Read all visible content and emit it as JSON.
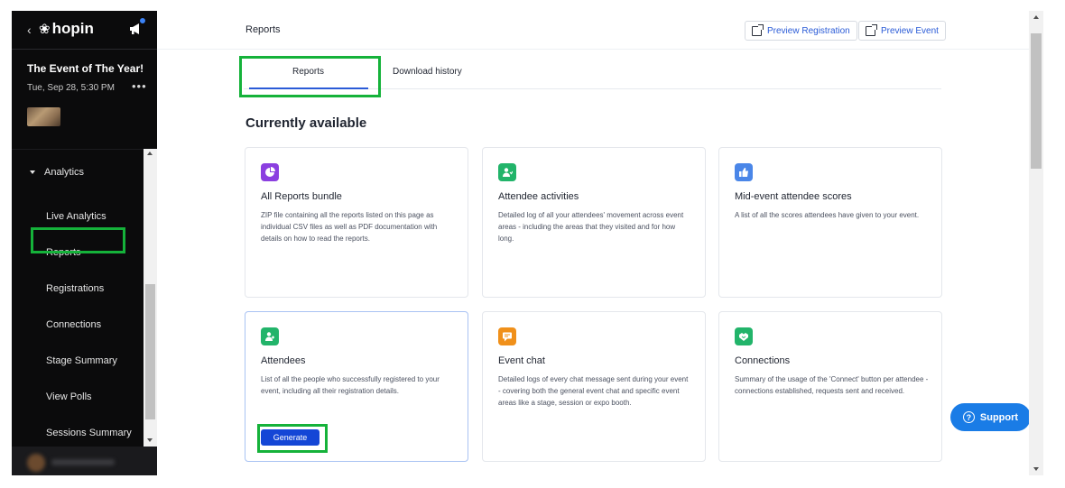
{
  "sidebar": {
    "logo_text": "hopin",
    "event_title": "The Event of The Year!",
    "event_date": "Tue, Sep 28, 5:30 PM",
    "group_label": "Analytics",
    "items": [
      {
        "label": "Live Analytics"
      },
      {
        "label": "Reports"
      },
      {
        "label": "Registrations"
      },
      {
        "label": "Connections"
      },
      {
        "label": "Stage Summary"
      },
      {
        "label": "View Polls"
      },
      {
        "label": "Sessions Summary"
      }
    ]
  },
  "header": {
    "title": "Reports",
    "preview_registration": "Preview Registration",
    "preview_event": "Preview Event"
  },
  "tabs": [
    {
      "label": "Reports"
    },
    {
      "label": "Download history"
    }
  ],
  "section_title": "Currently available",
  "cards": [
    {
      "icon": "pie-chart-icon",
      "color": "#8b3fe0",
      "title": "All Reports bundle",
      "description": "ZIP file containing all the reports listed on this page as individual CSV files as well as PDF documentation with details on how to read the reports."
    },
    {
      "icon": "user-activity-icon",
      "color": "#22b46a",
      "title": "Attendee activities",
      "description": "Detailed log of all your attendees' movement across event areas - including the areas that they visited and for how long."
    },
    {
      "icon": "thumbs-up-icon",
      "color": "#4a86e8",
      "title": "Mid-event attendee scores",
      "description": "A list of all the scores attendees have given to your event."
    },
    {
      "icon": "users-icon",
      "color": "#22b46a",
      "title": "Attendees",
      "description": "List of all the people who successfully registered to your event, including all their registration details.",
      "button": "Generate"
    },
    {
      "icon": "chat-icon",
      "color": "#f0901a",
      "title": "Event chat",
      "description": "Detailed logs of every chat message sent during your event - covering both the general event chat and specific event areas like a stage, session or expo booth."
    },
    {
      "icon": "handshake-icon",
      "color": "#22b46a",
      "title": "Connections",
      "description": "Summary of the usage of the 'Connect' button per attendee - connections established, requests sent and received."
    }
  ],
  "support_label": "Support"
}
